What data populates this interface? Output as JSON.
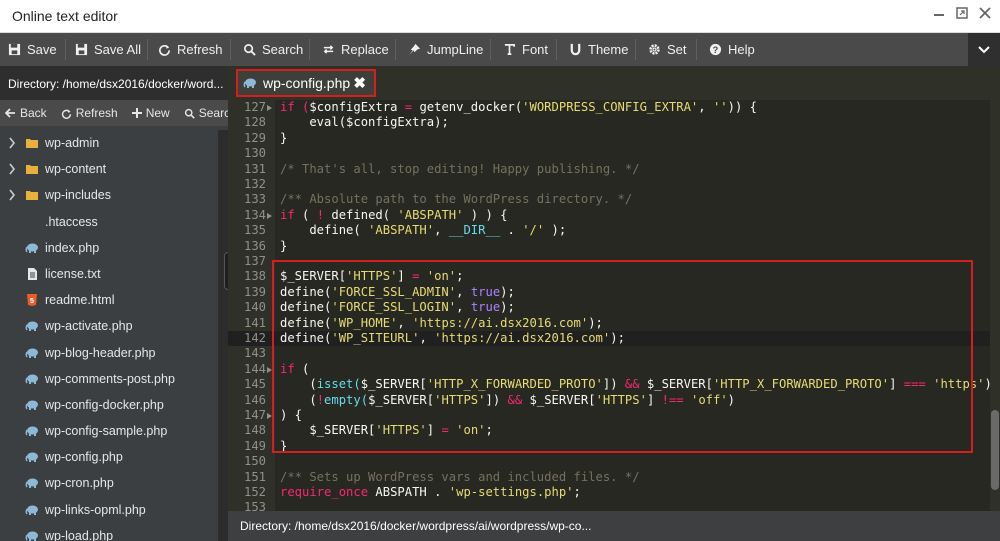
{
  "window": {
    "title": "Online text editor"
  },
  "toolbar": {
    "save": "Save",
    "save_all": "Save All",
    "refresh": "Refresh",
    "search": "Search",
    "replace": "Replace",
    "jumpline": "JumpLine",
    "font": "Font",
    "theme": "Theme",
    "set": "Set",
    "help": "Help"
  },
  "sidebar": {
    "directory": "Directory: /home/dsx2016/docker/word...",
    "actions": {
      "back": "Back",
      "refresh": "Refresh",
      "new": "New",
      "search": "Search"
    },
    "items": [
      {
        "name": "wp-admin",
        "type": "folder"
      },
      {
        "name": "wp-content",
        "type": "folder"
      },
      {
        "name": "wp-includes",
        "type": "folder"
      },
      {
        "name": ".htaccess",
        "type": "file"
      },
      {
        "name": "index.php",
        "type": "php"
      },
      {
        "name": "license.txt",
        "type": "txt"
      },
      {
        "name": "readme.html",
        "type": "html"
      },
      {
        "name": "wp-activate.php",
        "type": "php"
      },
      {
        "name": "wp-blog-header.php",
        "type": "php"
      },
      {
        "name": "wp-comments-post.php",
        "type": "php"
      },
      {
        "name": "wp-config-docker.php",
        "type": "php"
      },
      {
        "name": "wp-config-sample.php",
        "type": "php"
      },
      {
        "name": "wp-config.php",
        "type": "php"
      },
      {
        "name": "wp-cron.php",
        "type": "php"
      },
      {
        "name": "wp-links-opml.php",
        "type": "php"
      },
      {
        "name": "wp-load.php",
        "type": "php"
      }
    ]
  },
  "tab": {
    "label": "wp-config.php",
    "icon": "php-elephant-icon"
  },
  "editor": {
    "lines": [
      {
        "n": "127",
        "fold": true
      },
      {
        "n": "128"
      },
      {
        "n": "129"
      },
      {
        "n": "130"
      },
      {
        "n": "131"
      },
      {
        "n": "132"
      },
      {
        "n": "133"
      },
      {
        "n": "134",
        "fold": true
      },
      {
        "n": "135"
      },
      {
        "n": "136"
      },
      {
        "n": "137"
      },
      {
        "n": "138"
      },
      {
        "n": "139"
      },
      {
        "n": "140"
      },
      {
        "n": "141"
      },
      {
        "n": "142"
      },
      {
        "n": "143"
      },
      {
        "n": "144",
        "fold": true
      },
      {
        "n": "145"
      },
      {
        "n": "146"
      },
      {
        "n": "147",
        "fold": true
      },
      {
        "n": "148"
      },
      {
        "n": "149"
      },
      {
        "n": "150"
      },
      {
        "n": "151"
      },
      {
        "n": "152"
      },
      {
        "n": "153"
      }
    ],
    "code": {
      "l127a": "if (",
      "l127b": "$configExtra",
      "l127c": " = ",
      "l127d": "getenv_docker(",
      "l127e": "'WORDPRESS_CONFIG_EXTRA'",
      "l127f": ", ",
      "l127g": "''",
      "l127h": ")) {",
      "l128a": "    eval(",
      "l128b": "$configExtra",
      "l128c": ");",
      "l129": "}",
      "l131": "/* That's all, stop editing! Happy publishing. */",
      "l133": "/** Absolute path to the WordPress directory. */",
      "l134a": "if",
      "l134b": " ( ",
      "l134c": "!",
      "l134d": " defined( ",
      "l134e": "'ABSPATH'",
      "l134f": " ) ) {",
      "l135a": "    define( ",
      "l135b": "'ABSPATH'",
      "l135c": ", ",
      "l135d": "__DIR__",
      "l135e": " . ",
      "l135f": "'/'",
      "l135g": " );",
      "l136": "}",
      "l138a": "$_SERVER[",
      "l138b": "'HTTPS'",
      "l138c": "] ",
      "l138d": "=",
      "l138e": " ",
      "l138f": "'on'",
      "l138g": ";",
      "l139a": "define(",
      "l139b": "'FORCE_SSL_ADMIN'",
      "l139c": ", ",
      "l139d": "true",
      "l139e": ");",
      "l140a": "define(",
      "l140b": "'FORCE_SSL_LOGIN'",
      "l140c": ", ",
      "l140d": "true",
      "l140e": ");",
      "l141a": "define(",
      "l141b": "'WP_HOME'",
      "l141c": ", ",
      "l141d": "'https://ai.dsx2016.com'",
      "l141e": ");",
      "l142a": "define(",
      "l142b": "'WP_SITEURL'",
      "l142c": ", ",
      "l142d": "'https://ai.dsx2016.com'",
      "l142e": ");",
      "l144a": "if",
      "l144b": " (",
      "l145a": "    (",
      "l145b": "isset(",
      "l145c": "$_SERVER[",
      "l145d": "'HTTP_X_FORWARDED_PROTO'",
      "l145e": "]) ",
      "l145f": "&&",
      "l145g": " $_SERVER[",
      "l145h": "'HTTP_X_FORWARDED_PROTO'",
      "l145i": "] ",
      "l145j": "===",
      "l145k": " ",
      "l145l": "'https'",
      "l145m": ") ",
      "l145n": "||",
      "l146a": "    (",
      "l146b": "!",
      "l146c": "empty(",
      "l146d": "$_SERVER[",
      "l146e": "'HTTPS'",
      "l146f": "]) ",
      "l146g": "&&",
      "l146h": " $_SERVER[",
      "l146i": "'HTTPS'",
      "l146j": "] ",
      "l146k": "!==",
      "l146l": " ",
      "l146m": "'off'",
      "l146n": ")",
      "l147": ") {",
      "l148a": "    $_SERVER[",
      "l148b": "'HTTPS'",
      "l148c": "] ",
      "l148d": "=",
      "l148e": " ",
      "l148f": "'on'",
      "l148g": ";",
      "l149": "}",
      "l151": "/** Sets up WordPress vars and included files. */",
      "l152a": "require_once",
      "l152b": " ABSPATH . ",
      "l152c": "'wp-settings.php'",
      "l152d": ";"
    }
  },
  "status": {
    "text": "Directory: /home/dsx2016/docker/wordpress/ai/wordpress/wp-co..."
  },
  "colors": {
    "highlight_border": "#d41f1f",
    "folder": "#e8b13c",
    "php": "#8fb7d6"
  }
}
